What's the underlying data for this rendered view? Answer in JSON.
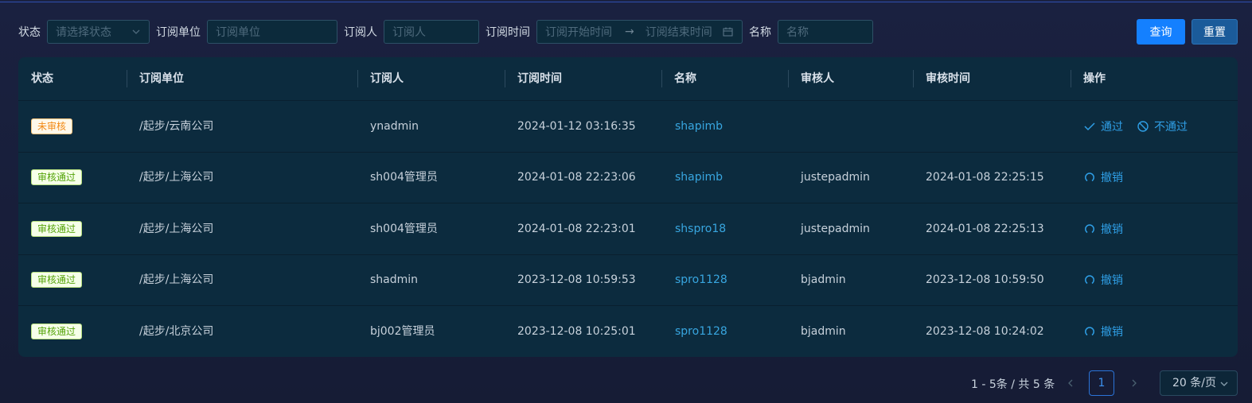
{
  "filters": {
    "status_label": "状态",
    "status_placeholder": "请选择状态",
    "unit_label": "订阅单位",
    "unit_placeholder": "订阅单位",
    "person_label": "订阅人",
    "person_placeholder": "订阅人",
    "time_label": "订阅时间",
    "time_start_placeholder": "订阅开始时间",
    "time_arrow": "→",
    "time_end_placeholder": "订阅结束时间",
    "name_label": "名称",
    "name_placeholder": "名称",
    "query_button": "查询",
    "reset_button": "重置"
  },
  "table": {
    "columns": [
      "状态",
      "订阅单位",
      "订阅人",
      "订阅时间",
      "名称",
      "审核人",
      "审核时间",
      "操作"
    ],
    "rows": [
      {
        "status": "未审核",
        "status_kind": "pending",
        "unit": "/起步/云南公司",
        "person": "ynadmin",
        "time": "2024-01-12 03:16:35",
        "name": "shapimb",
        "reviewer": "",
        "review_time": "",
        "actions": [
          "通过",
          "不通过"
        ]
      },
      {
        "status": "审核通过",
        "status_kind": "passed",
        "unit": "/起步/上海公司",
        "person": "sh004管理员",
        "time": "2024-01-08 22:23:06",
        "name": "shapimb",
        "reviewer": "justepadmin",
        "review_time": "2024-01-08 22:25:15",
        "actions": [
          "撤销"
        ]
      },
      {
        "status": "审核通过",
        "status_kind": "passed",
        "unit": "/起步/上海公司",
        "person": "sh004管理员",
        "time": "2024-01-08 22:23:01",
        "name": "shspro18",
        "reviewer": "justepadmin",
        "review_time": "2024-01-08 22:25:13",
        "actions": [
          "撤销"
        ]
      },
      {
        "status": "审核通过",
        "status_kind": "passed",
        "unit": "/起步/上海公司",
        "person": "shadmin",
        "time": "2023-12-08 10:59:53",
        "name": "spro1128",
        "reviewer": "bjadmin",
        "review_time": "2023-12-08 10:59:50",
        "actions": [
          "撤销"
        ]
      },
      {
        "status": "审核通过",
        "status_kind": "passed",
        "unit": "/起步/北京公司",
        "person": "bj002管理员",
        "time": "2023-12-08 10:25:01",
        "name": "spro1128",
        "reviewer": "bjadmin",
        "review_time": "2023-12-08 10:24:02",
        "actions": [
          "撤销"
        ]
      }
    ]
  },
  "pagination": {
    "total_text": "1 - 5条 / 共 5 条",
    "current_page": "1",
    "page_size": "20 条/页"
  },
  "colors": {
    "accent": "#1480ff",
    "link": "#38a6e0",
    "pending": "#f28a16",
    "passed": "#56a40a"
  },
  "icons": {
    "status_dropdown": "chevron-down-icon",
    "date_picker": "calendar-icon",
    "approve": "check-icon",
    "reject": "ban-icon",
    "revoke": "undo-icon",
    "prev": "chevron-left-icon",
    "next": "chevron-right-icon"
  }
}
